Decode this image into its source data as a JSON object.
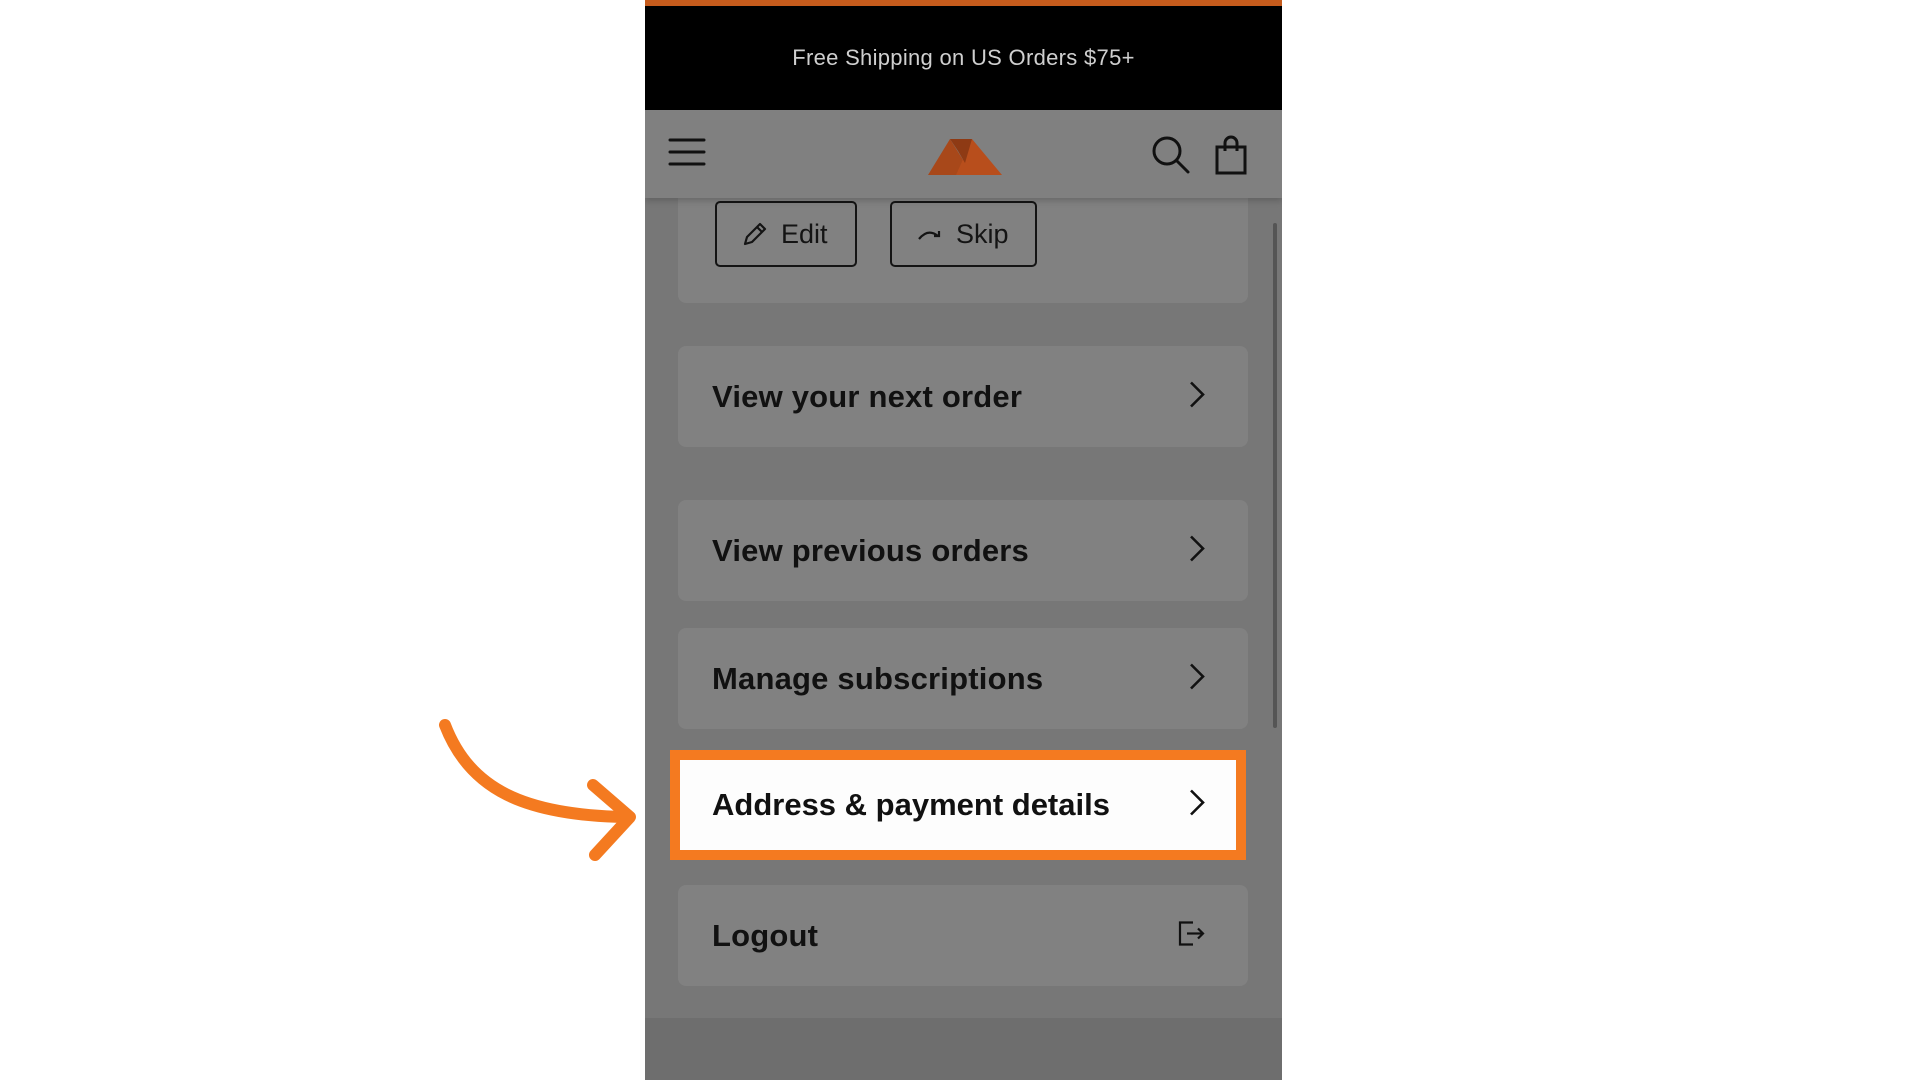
{
  "announcement": {
    "text": "Free Shipping on US Orders $75+"
  },
  "header": {
    "logo": "brand-logo",
    "menu_icon": "hamburger-menu-icon",
    "search_icon": "search-icon",
    "cart_icon": "shopping-bag-icon"
  },
  "order_actions": {
    "edit_label": "Edit",
    "skip_label": "Skip"
  },
  "menu": {
    "items": [
      {
        "label": "View your next order",
        "icon": "chevron-right-icon"
      },
      {
        "label": "View previous orders",
        "icon": "chevron-right-icon"
      },
      {
        "label": "Manage subscriptions",
        "icon": "chevron-right-icon"
      },
      {
        "label": "Address & payment details",
        "icon": "chevron-right-icon",
        "highlighted": true
      },
      {
        "label": "Logout",
        "icon": "logout-icon"
      }
    ]
  },
  "colors": {
    "accent": "#f47a20",
    "brand": "#c0501c",
    "announcement_bg": "#000000",
    "overlay_bg": "#7a7a7a"
  }
}
